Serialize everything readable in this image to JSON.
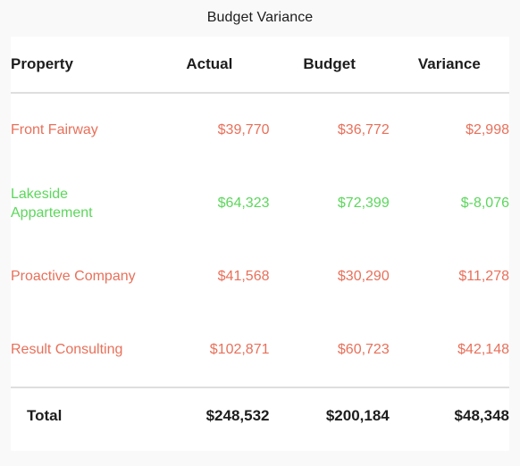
{
  "chart_data": {
    "type": "table",
    "title": "Budget Variance",
    "columns": [
      "Property",
      "Actual",
      "Budget",
      "Variance"
    ],
    "rows": [
      {
        "property": "Front Fairway",
        "actual": "$39,770",
        "budget": "$36,772",
        "variance": "$2,998",
        "color": "#e8705a"
      },
      {
        "property": "Lakeside Appartement",
        "actual": "$64,323",
        "budget": "$72,399",
        "variance": "$-8,076",
        "color": "#5bd75b"
      },
      {
        "property": "Proactive Company",
        "actual": "$41,568",
        "budget": "$30,290",
        "variance": "$11,278",
        "color": "#e8705a"
      },
      {
        "property": "Result Consulting",
        "actual": "$102,871",
        "budget": "$60,723",
        "variance": "$42,148",
        "color": "#e8705a"
      }
    ],
    "total": {
      "label": "Total",
      "actual": "$248,532",
      "budget": "$200,184",
      "variance": "$48,348"
    },
    "colors": {
      "positive_variance": "#e8705a",
      "negative_variance": "#5bd75b",
      "text": "#1d1d1d",
      "divider": "#dedede",
      "card_background": "#ffffff",
      "page_background": "#f9f9f9"
    }
  }
}
